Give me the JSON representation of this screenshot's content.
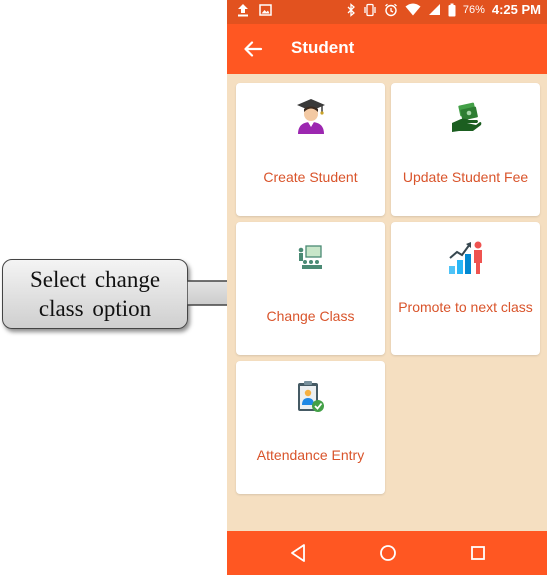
{
  "annotation": {
    "text": "Select  change\nclass option"
  },
  "status_bar": {
    "battery": "76%",
    "time": "4:25 PM"
  },
  "app_bar": {
    "title": "Student"
  },
  "menu": {
    "items": [
      {
        "label": "Create Student",
        "icon": "graduate-icon"
      },
      {
        "label": "Update Student Fee",
        "icon": "money-hand-icon"
      },
      {
        "label": "Change Class",
        "icon": "classroom-icon"
      },
      {
        "label": "Promote to next class",
        "icon": "growth-chart-icon"
      },
      {
        "label": "Attendance Entry",
        "icon": "attendance-clipboard-icon"
      }
    ]
  },
  "nav_bar": {
    "icons": [
      "back-triangle-icon",
      "home-circle-icon",
      "recents-square-icon"
    ]
  },
  "colors": {
    "status_bar": "#e2521f",
    "app_bar": "#ff5722",
    "background": "#f5dfc1",
    "label": "#d9542b"
  }
}
